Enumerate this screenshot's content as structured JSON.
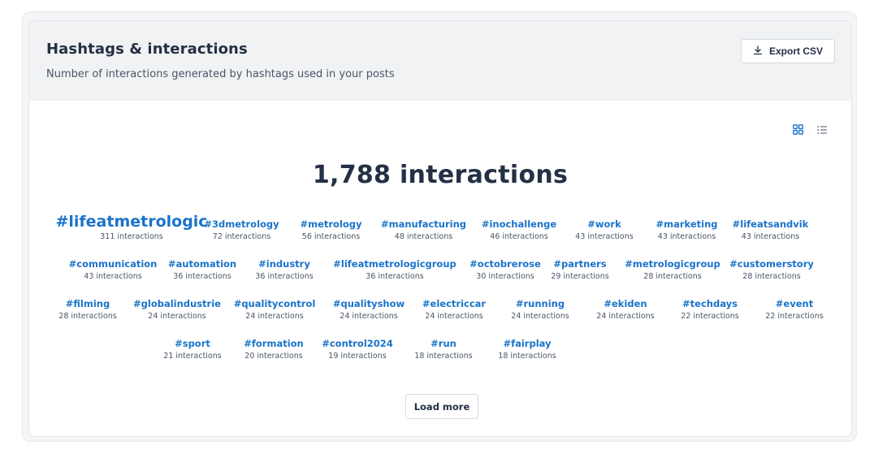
{
  "header": {
    "title": "Hashtags & interactions",
    "subtitle": "Number of interactions generated by hashtags used in your posts",
    "export_label": "Export CSV"
  },
  "view_toggle": {
    "grid_icon": "grid-view-icon",
    "list_icon": "list-view-icon",
    "active": "grid"
  },
  "summary": {
    "total": "1,788 interactions"
  },
  "colors": {
    "accent": "#1a73c9",
    "text": "#243044",
    "muted": "#4a5567",
    "header_bg": "#f1f2f4"
  },
  "hashtag_rows": [
    [
      {
        "tag": "#lifeatmetrologic",
        "count": "311 interactions"
      },
      {
        "tag": "#3dmetrology",
        "count": "72 interactions"
      },
      {
        "tag": "#metrology",
        "count": "56 interactions"
      },
      {
        "tag": "#manufacturing",
        "count": "48 interactions"
      },
      {
        "tag": "#inochallenge",
        "count": "46 interactions"
      },
      {
        "tag": "#work",
        "count": "43 interactions"
      },
      {
        "tag": "#marketing",
        "count": "43 interactions"
      },
      {
        "tag": "#lifeatsandvik",
        "count": "43 interactions"
      }
    ],
    [
      {
        "tag": "#communication",
        "count": "43 interactions"
      },
      {
        "tag": "#automation",
        "count": "36 interactions"
      },
      {
        "tag": "#industry",
        "count": "36 interactions"
      },
      {
        "tag": "#lifeatmetrologicgroup",
        "count": "36 interactions"
      },
      {
        "tag": "#octobrerose",
        "count": "30 interactions"
      },
      {
        "tag": "#partners",
        "count": "29 interactions"
      },
      {
        "tag": "#metrologicgroup",
        "count": "28 interactions"
      },
      {
        "tag": "#customerstory",
        "count": "28 interactions"
      }
    ],
    [
      {
        "tag": "#filming",
        "count": "28 interactions"
      },
      {
        "tag": "#globalindustrie",
        "count": "24 interactions"
      },
      {
        "tag": "#qualitycontrol",
        "count": "24 interactions"
      },
      {
        "tag": "#qualityshow",
        "count": "24 interactions"
      },
      {
        "tag": "#electriccar",
        "count": "24 interactions"
      },
      {
        "tag": "#running",
        "count": "24 interactions"
      },
      {
        "tag": "#ekiden",
        "count": "24 interactions"
      },
      {
        "tag": "#techdays",
        "count": "22 interactions"
      },
      {
        "tag": "#event",
        "count": "22 interactions"
      }
    ],
    [
      {
        "tag": "#sport",
        "count": "21 interactions"
      },
      {
        "tag": "#formation",
        "count": "20 interactions"
      },
      {
        "tag": "#control2024",
        "count": "19 interactions"
      },
      {
        "tag": "#run",
        "count": "18 interactions"
      },
      {
        "tag": "#fairplay",
        "count": "18 interactions"
      }
    ]
  ],
  "load_more_label": "Load more"
}
